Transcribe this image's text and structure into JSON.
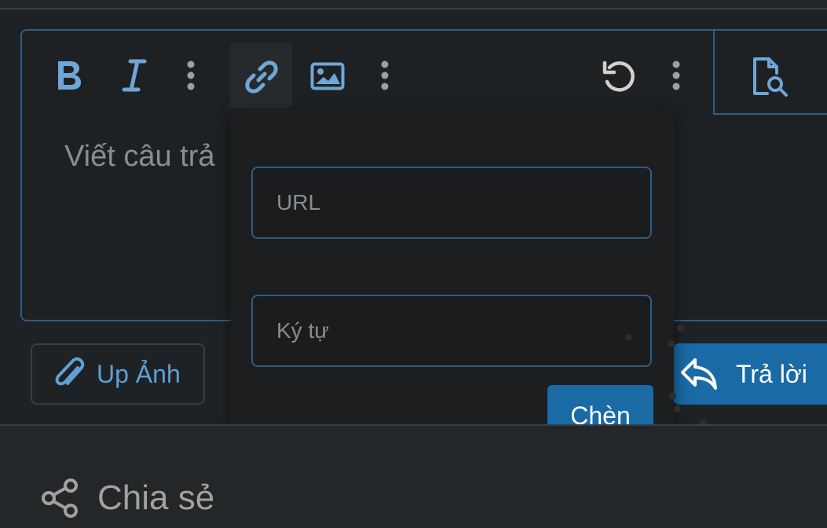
{
  "toolbar": {
    "bold_icon": "bold-icon",
    "italic_icon": "italic-icon",
    "more_icon": "more-vertical-icon",
    "link_icon": "link-icon",
    "image_icon": "image-icon",
    "undo_icon": "undo-icon",
    "preview_icon": "file-search-icon"
  },
  "editor": {
    "placeholder": "Viết câu trả"
  },
  "link_popup": {
    "url_placeholder": "URL",
    "text_placeholder": "Ký tự",
    "insert_label": "Chèn"
  },
  "actions": {
    "upload_label": "Up Ảnh",
    "reply_label": "Trả lời"
  },
  "share": {
    "label": "Chia sẻ"
  },
  "colors": {
    "accent": "#1a6aa6",
    "icon_blue": "#5ea1d6",
    "border_blue": "#2f5d86",
    "background": "#1e2124"
  }
}
